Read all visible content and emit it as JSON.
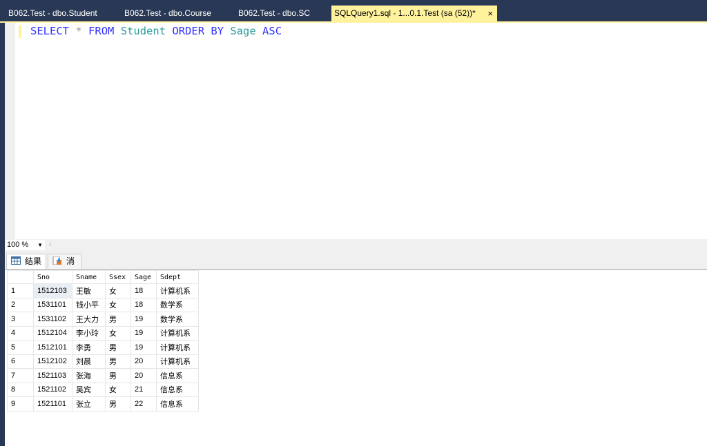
{
  "tabs": [
    {
      "label": "B062.Test - dbo.Student"
    },
    {
      "label": "B062.Test - dbo.Course"
    },
    {
      "label": "B062.Test - dbo.SC"
    },
    {
      "label": "SQLQuery1.sql - 1...0.1.Test (sa (52))*",
      "active": true,
      "close": "×"
    }
  ],
  "editor": {
    "tokens": [
      "SELECT",
      "*",
      "FROM",
      "Student",
      "ORDER BY",
      "Sage",
      "ASC"
    ]
  },
  "zoom": {
    "value": "100 %"
  },
  "result_tabs": [
    {
      "label": "结果"
    },
    {
      "label": "消息"
    }
  ],
  "grid": {
    "columns": [
      "Sno",
      "Sname",
      "Ssex",
      "Sage",
      "Sdept"
    ],
    "rows": [
      [
        "1",
        "1512103",
        "王敏",
        "女",
        "18",
        "计算机系"
      ],
      [
        "2",
        "1531101",
        "钱小平",
        "女",
        "18",
        "数学系"
      ],
      [
        "3",
        "1531102",
        "王大力",
        "男",
        "19",
        "数学系"
      ],
      [
        "4",
        "1512104",
        "李小玲",
        "女",
        "19",
        "计算机系"
      ],
      [
        "5",
        "1512101",
        "李勇",
        "男",
        "19",
        "计算机系"
      ],
      [
        "6",
        "1512102",
        "刘晨",
        "男",
        "20",
        "计算机系"
      ],
      [
        "7",
        "1521103",
        "张海",
        "男",
        "20",
        "信息系"
      ],
      [
        "8",
        "1521102",
        "吴宾",
        "女",
        "21",
        "信息系"
      ],
      [
        "9",
        "1521101",
        "张立",
        "男",
        "22",
        "信息系"
      ]
    ]
  }
}
